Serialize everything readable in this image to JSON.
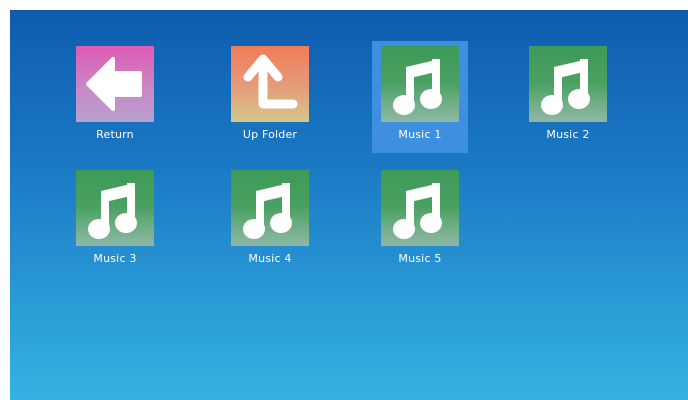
{
  "items": [
    {
      "label": "Return",
      "icon": "arrow-left-icon",
      "selected": false
    },
    {
      "label": "Up Folder",
      "icon": "arrow-up-return-icon",
      "selected": false
    },
    {
      "label": "Music 1",
      "icon": "music-note-icon",
      "selected": true
    },
    {
      "label": "Music 2",
      "icon": "music-note-icon",
      "selected": false
    },
    {
      "label": "Music 3",
      "icon": "music-note-icon",
      "selected": false
    },
    {
      "label": "Music 4",
      "icon": "music-note-icon",
      "selected": false
    },
    {
      "label": "Music 5",
      "icon": "music-note-icon",
      "selected": false
    }
  ],
  "colors": {
    "background_top": "#0e5cae",
    "background_bottom": "#33b2e3",
    "selection": "#3f8fe0",
    "music_tile": "#3d9a58",
    "return_tile": "#de5bb4",
    "up_folder_tile": "#f07c58"
  }
}
